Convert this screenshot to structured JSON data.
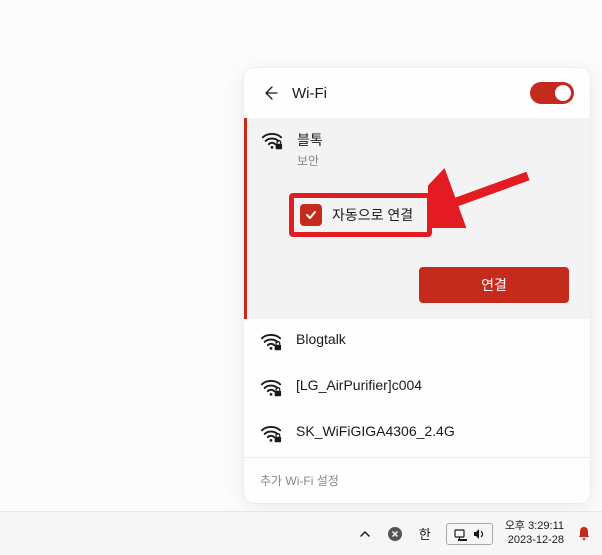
{
  "panel": {
    "title": "Wi-Fi",
    "toggle_on": true,
    "footer": "추가 Wi-Fi 설정"
  },
  "networks": {
    "selected": {
      "name": "블톡",
      "sub": "보안",
      "auto_connect_label": "자동으로 연결",
      "auto_connect_checked": true,
      "connect_button": "연결"
    },
    "others": [
      {
        "name": "Blogtalk"
      },
      {
        "name": "[LG_AirPurifier]c004"
      },
      {
        "name": "SK_WiFiGIGA4306_2.4G"
      }
    ]
  },
  "taskbar": {
    "ime": "한",
    "time": "오후 3:29:11",
    "date": "2023-12-28"
  },
  "colors": {
    "accent": "#c42b1c",
    "highlight": "#e31b23"
  }
}
